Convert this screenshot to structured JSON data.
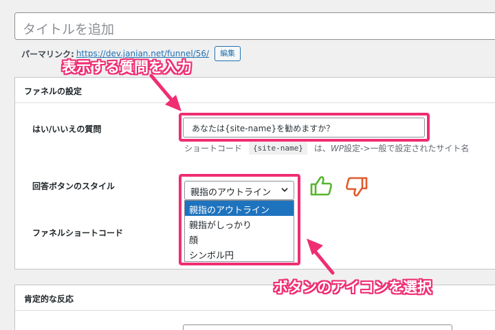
{
  "title": {
    "placeholder": "タイトルを追加"
  },
  "permalink": {
    "label": "パーマリンク:",
    "url": "https://dev.janian.net/funnel/56/",
    "edit_label": "編集"
  },
  "funnel_settings": {
    "heading": "ファネルの設定",
    "question_label": "はい/いいえの質問",
    "question_value": "あなたは{site-name}を勧めますか？",
    "hint_prefix": "ショートコード",
    "hint_code": "{site-name}",
    "hint_mid": "は、",
    "hint_em": "WP",
    "hint_suffix": "設定->一般で設定されたサイト名",
    "style_label": "回答ボタンのスタイル",
    "style_selected": "親指のアウトライン",
    "style_options": [
      "親指のアウトライン",
      "親指がしっかり",
      "顔",
      "シンボル円"
    ],
    "shortcode_label": "ファネルショートコード"
  },
  "positive_reaction": {
    "heading": "肯定的な反応"
  },
  "annotations": {
    "top_callout": "表示する質問を入力",
    "bottom_callout": "ボタンのアイコンを選択"
  },
  "colors": {
    "highlight": "#ef2d72",
    "thumbs_up": "#56b52c",
    "thumbs_down": "#e05a2a",
    "selected_option": "#1e73be",
    "link": "#2271b1"
  },
  "icons": [
    "thumbs-up-outline-icon",
    "thumbs-down-outline-icon",
    "chevron-down-icon",
    "arrow-icon"
  ]
}
